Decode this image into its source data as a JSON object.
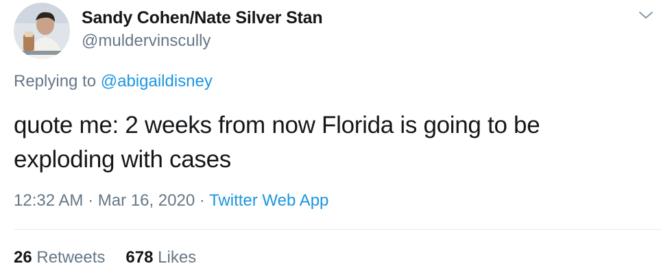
{
  "user": {
    "display_name": "Sandy Cohen/Nate Silver Stan",
    "handle": "@muldervinscully"
  },
  "reply": {
    "prefix": "Replying to",
    "target": "@abigaildisney"
  },
  "tweet": {
    "text_line1": "quote me: 2 weeks from now Florida is going to be",
    "text_line2": "exploding with cases"
  },
  "meta": {
    "time": "12:32 AM",
    "date": "Mar 16, 2020",
    "separator": "·",
    "source": "Twitter Web App"
  },
  "stats": {
    "retweets_count": "26",
    "retweets_label": "Retweets",
    "likes_count": "678",
    "likes_label": "Likes"
  },
  "colors": {
    "link": "#1b95e0",
    "secondary_text": "#657786",
    "primary_text": "#14171a"
  },
  "icons": {
    "caret": "chevron-down-icon",
    "avatar": "user-avatar"
  }
}
